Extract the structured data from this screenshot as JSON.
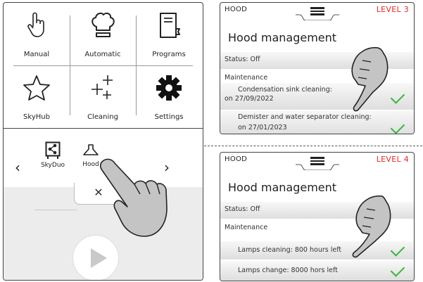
{
  "home": {
    "tiles": [
      {
        "label": "Manual",
        "icon": "hand-icon"
      },
      {
        "label": "Automatic",
        "icon": "chef-hat-icon"
      },
      {
        "label": "Programs",
        "icon": "book-icon"
      },
      {
        "label": "SkyHub",
        "icon": "star-icon"
      },
      {
        "label": "Cleaning",
        "icon": "sparkle-icon"
      },
      {
        "label": "Settings",
        "icon": "gear-icon"
      }
    ],
    "carousel": {
      "items": [
        {
          "label": "SkyDuo",
          "icon": "skyduo-icon"
        },
        {
          "label": "Hood",
          "icon": "hood-icon"
        }
      ],
      "prev_arrow": "‹",
      "next_arrow": "›",
      "close_symbol": "✕"
    }
  },
  "screen_level3": {
    "header_title": "HOOD",
    "level": "LEVEL 3",
    "heading": "Hood management",
    "status": "Status: Off",
    "maintenance_label": "Maintenance",
    "items": [
      {
        "line1": "Condensation sink cleaning:",
        "line2": "on 27/09/2022"
      },
      {
        "line1": "Demister and water separator cleaning:",
        "line2": "on 27/01/2023"
      }
    ]
  },
  "screen_level4": {
    "header_title": "HOOD",
    "level": "LEVEL 4",
    "heading": "Hood management",
    "status": "Status: Off",
    "maintenance_label": "Maintenance",
    "items": [
      {
        "line1": "Lamps cleaning: 800 hours left"
      },
      {
        "line1": "Lamps change: 8000 hors left"
      }
    ]
  },
  "colors": {
    "level_text": "#e02a2a",
    "check": "#3cb43c"
  }
}
